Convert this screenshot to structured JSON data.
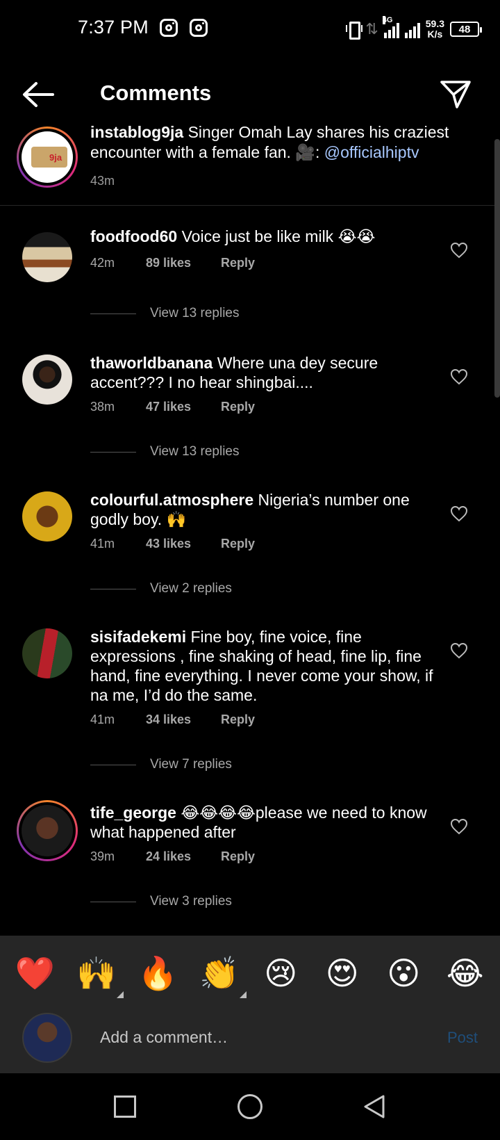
{
  "status_bar": {
    "time": "7:37 PM",
    "network": "4G",
    "speed_value": "59.3",
    "speed_unit": "K/s",
    "battery": "48",
    "icons": [
      "instagram-icon",
      "instagram-icon",
      "vibrate-icon",
      "data-arrows-icon",
      "signal-icon",
      "signal-icon",
      "battery-icon"
    ]
  },
  "header": {
    "title": "Comments",
    "back_icon": "back-arrow-icon",
    "share_icon": "send-icon"
  },
  "caption": {
    "username": "instablog9ja",
    "text": "Singer Omah Lay shares his craziest encounter with a female fan. 🎥: ",
    "link": "@officialhiptv",
    "time": "43m"
  },
  "comments": [
    {
      "username": "foodfood60",
      "text": "Voice just be like milk 😭😭",
      "time": "42m",
      "likes": "89 likes",
      "reply": "Reply",
      "view_replies": "View 13 replies"
    },
    {
      "username": "thaworldbanana",
      "text": "Where una dey secure accent??? I no hear shingbai....",
      "time": "38m",
      "likes": "47 likes",
      "reply": "Reply",
      "view_replies": "View 13 replies"
    },
    {
      "username": "colourful.atmosphere",
      "text": "Nigeria’s number one godly boy. 🙌",
      "time": "41m",
      "likes": "43 likes",
      "reply": "Reply",
      "view_replies": "View 2 replies"
    },
    {
      "username": "sisifadekemi",
      "text": "Fine boy, fine voice, fine expressions , fine shaking of head, fine lip, fine hand, fine everything. I never come your show, if na me, I’d do the same.",
      "time": "41m",
      "likes": "34 likes",
      "reply": "Reply",
      "view_replies": "View 7 replies"
    },
    {
      "username": "tife_george",
      "text": "😂😂😂😂please we need to know what happened after",
      "time": "39m",
      "likes": "24 likes",
      "reply": "Reply",
      "view_replies": "View 3 replies"
    }
  ],
  "emoji_bar": [
    "❤️",
    "🙌",
    "🔥",
    "👏",
    "😢",
    "😍",
    "😮",
    "😂"
  ],
  "input": {
    "placeholder": "Add a comment…",
    "post_label": "Post"
  },
  "nav": {
    "icons": [
      "recents-square-icon",
      "home-circle-icon",
      "back-triangle-icon"
    ]
  },
  "colors": {
    "background": "#000000",
    "secondary_text": "#a8a8a8",
    "link": "#a8c8ff",
    "post_disabled": "#1f4e7a",
    "bar_background": "#262626"
  }
}
